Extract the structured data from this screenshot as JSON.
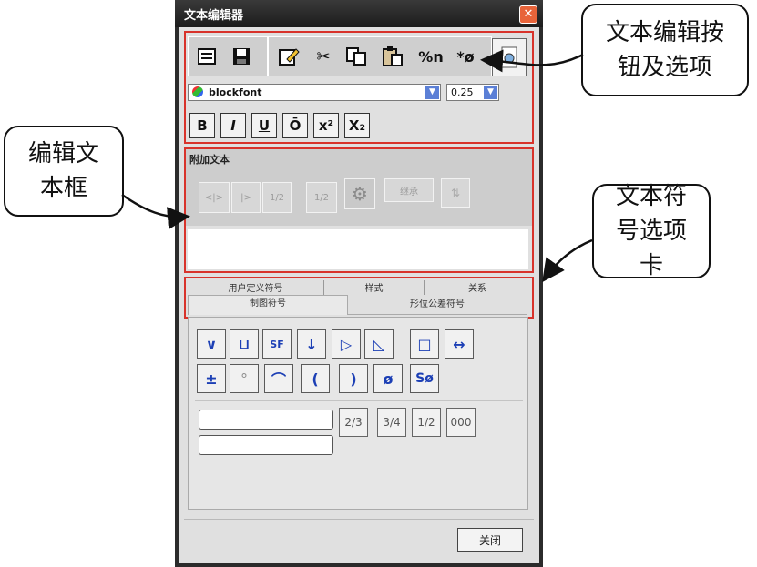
{
  "dialog": {
    "title": "文本编辑器",
    "close_glyph": "✕"
  },
  "toolbar": {
    "icons": [
      "clear-icon",
      "save-icon",
      "edit-icon",
      "cut-icon",
      "copy-icon",
      "paste-icon",
      "delete-format-icon",
      "insert-symbol-icon",
      "preview-icon"
    ],
    "glyphs": {
      "scissors": "✂",
      "delete_text": "%n",
      "insert_symbol": "*ø"
    }
  },
  "font_select": {
    "value": "blockfont"
  },
  "size_select": {
    "value": "0.25"
  },
  "format_buttons": {
    "bold": "B",
    "italic": "I",
    "underline": "U",
    "overline": "Ō",
    "superscript": "x²",
    "subscript": "X₂"
  },
  "append_text": {
    "label": "附加文本",
    "button_labels": [
      "<|>",
      "|>",
      "1/2",
      "1/2",
      "",
      "继承",
      ""
    ]
  },
  "tabs": {
    "row1": [
      "用户定义符号",
      "样式",
      "关系"
    ],
    "row2": [
      "制图符号",
      "形位公差符号"
    ],
    "active": "制图符号"
  },
  "symbols": {
    "row1": [
      "∨",
      "⊔",
      "SF",
      "↓",
      "▷",
      "◺",
      "□",
      "↔"
    ],
    "row2": [
      "±",
      "°",
      "⌒",
      "(",
      ")",
      "ø",
      "Sø"
    ]
  },
  "fraction_buttons": [
    "2/3",
    "3/4",
    "1/2",
    "000"
  ],
  "footer": {
    "close_label": "关闭"
  },
  "callouts": {
    "toolbar": "文本编辑按钮及选项",
    "textbox": "编辑文本框",
    "tabs": "文本符号选项卡"
  }
}
